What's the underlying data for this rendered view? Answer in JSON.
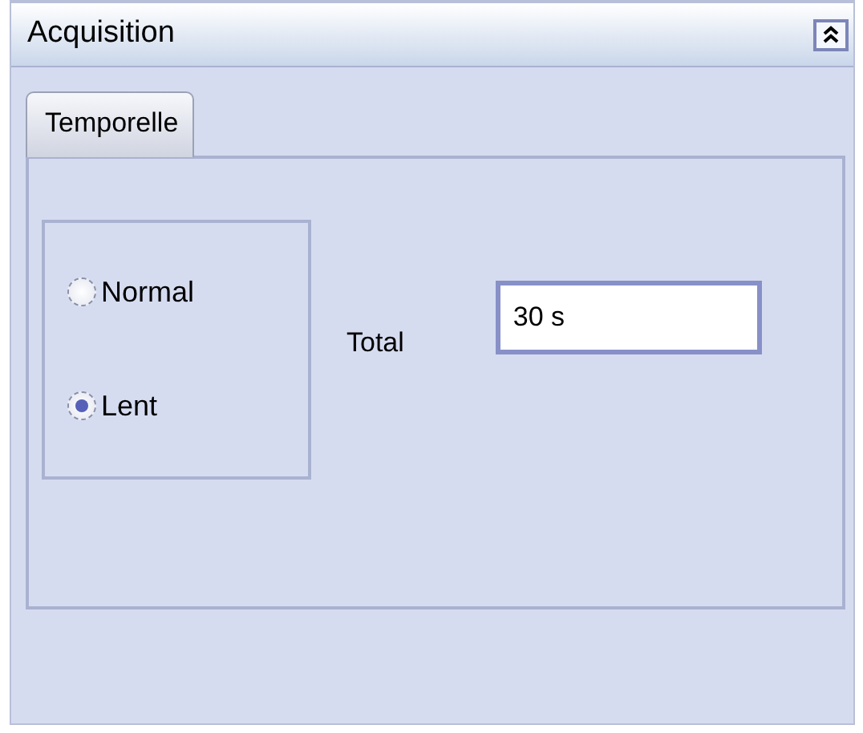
{
  "panel": {
    "title": "Acquisition"
  },
  "tabs": [
    {
      "label": "Temporelle",
      "selected": true
    }
  ],
  "mode": [
    {
      "label": "Normal",
      "selected": false
    },
    {
      "label": "Lent",
      "selected": true
    }
  ],
  "total": {
    "label": "Total",
    "value": "30 s"
  }
}
